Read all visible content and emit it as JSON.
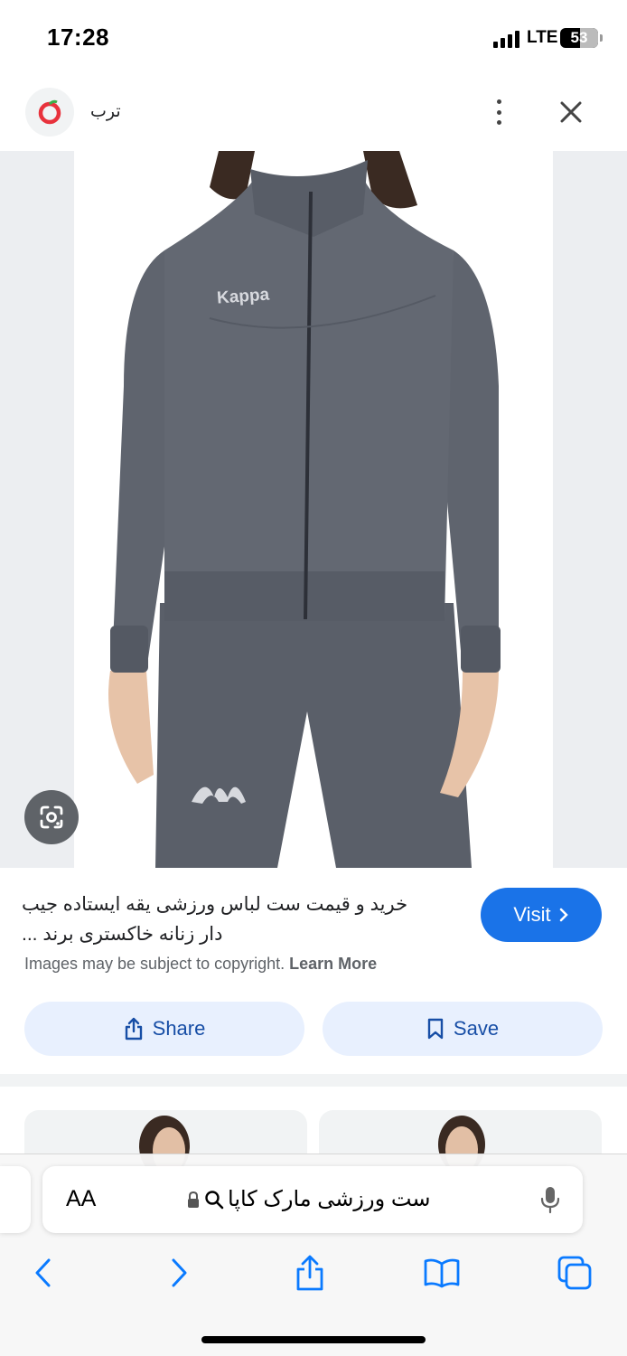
{
  "status_bar": {
    "time": "17:28",
    "network": "LTE",
    "battery": "53",
    "battery_level_percent": 53
  },
  "header": {
    "site_name": "ترب",
    "site_icon": "torob-logo",
    "more_icon": "more-vertical-icon",
    "close_icon": "close-icon"
  },
  "image": {
    "logo_text": "Kappa",
    "lens_icon": "google-lens-icon"
  },
  "result": {
    "title": "خرید و قیمت ست لباس ورزشی یقه ایستاده جیب دار زنانه خاکستری برند ...",
    "visit_label": "Visit",
    "copyright_text": "Images may be subject to copyright.",
    "learn_more": "Learn More"
  },
  "actions": {
    "share_label": "Share",
    "save_label": "Save"
  },
  "browser": {
    "aa_label": "AA",
    "url_text": "ست ورزشی مارک کاپا",
    "nav": [
      "back-icon",
      "forward-icon",
      "share-icon",
      "bookmarks-icon",
      "tabs-icon"
    ]
  },
  "colors": {
    "accent": "#1a73e8",
    "button_bg": "#e8f0fe",
    "button_text": "#174ea6",
    "garment": "#5c616b"
  }
}
